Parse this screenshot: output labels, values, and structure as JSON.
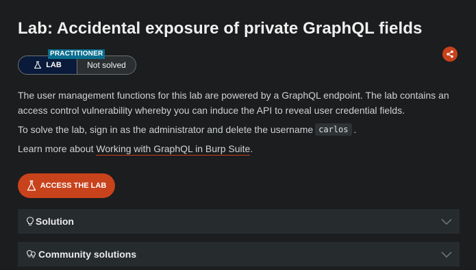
{
  "header": {
    "title": "Lab: Accidental exposure of private GraphQL fields",
    "share_icon": "share-icon"
  },
  "status": {
    "level_badge": "PRACTITIONER",
    "lab_label": "LAB",
    "lab_icon": "flask-icon",
    "solved_status": "Not solved"
  },
  "content": {
    "paragraph_1": "The user management functions for this lab are powered by a GraphQL endpoint. The lab contains an access control vulnerability whereby you can induce the API to reveal user credential fields.",
    "paragraph_2_prefix": "To solve the lab, sign in as the administrator and delete the username",
    "paragraph_2_code": "carlos",
    "paragraph_2_suffix": ".",
    "paragraph_3_prefix": "Learn more about",
    "paragraph_3_link": "Working with GraphQL in Burp Suite",
    "paragraph_3_suffix": "."
  },
  "actions": {
    "access_lab_label": "ACCESS THE LAB",
    "access_lab_icon": "flask-icon"
  },
  "accordions": [
    {
      "label": "Solution",
      "icon": "lightbulb-icon"
    },
    {
      "label": "Community solutions",
      "icon": "community-lightbulbs-icon"
    }
  ],
  "colors": {
    "background": "#1b1d1e",
    "accent": "#c8421c",
    "badge": "#0a6e8f",
    "lab_pill": "#0a1a3a",
    "accordion_bg": "#262b2e"
  }
}
